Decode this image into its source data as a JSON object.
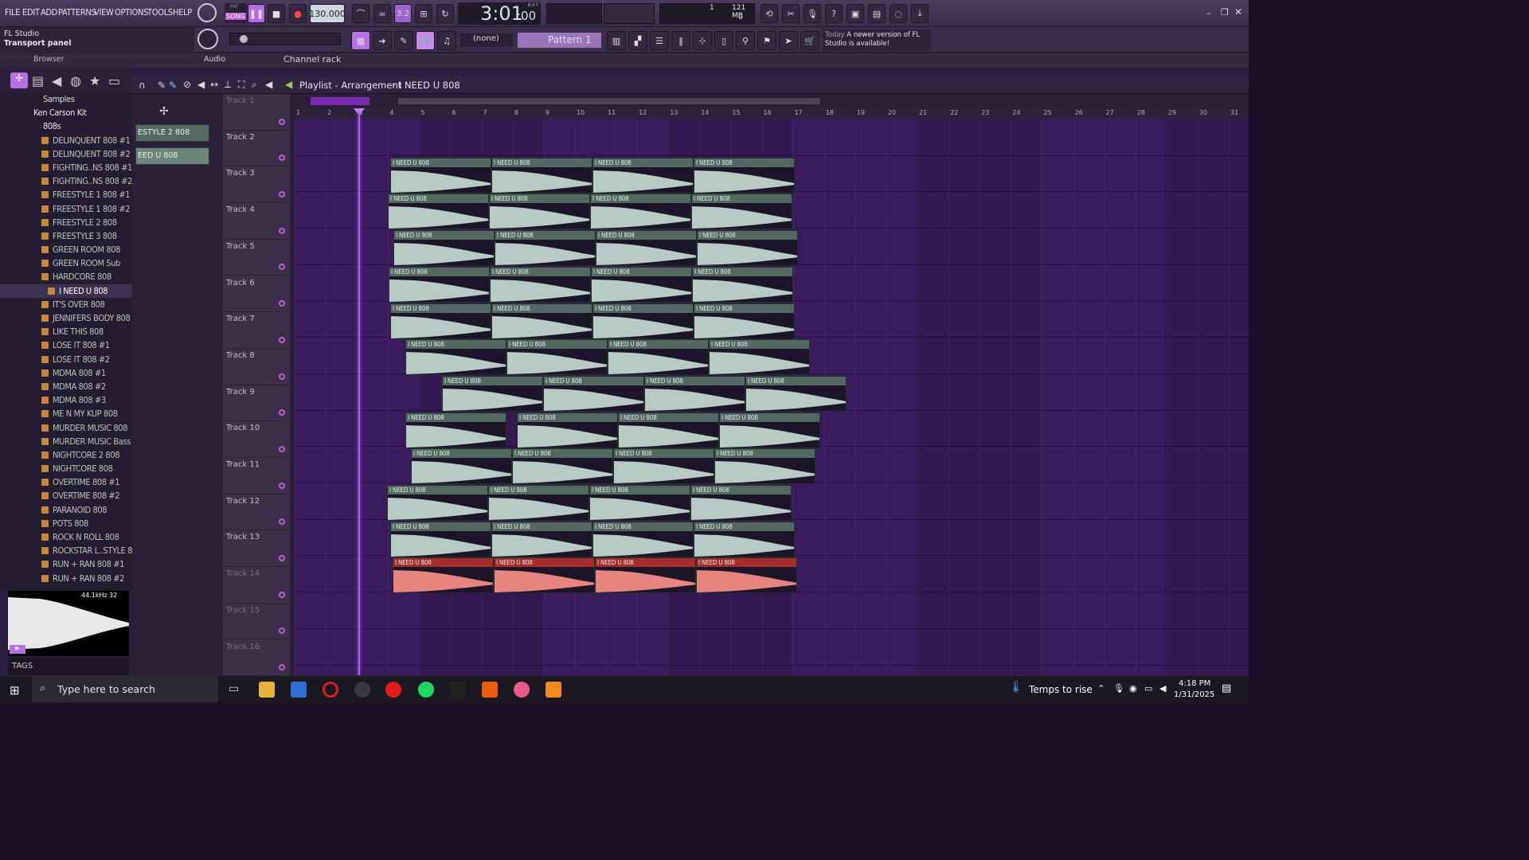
{
  "menu": [
    "FILE",
    "EDIT",
    "ADD",
    "PATTERNS",
    "VIEW",
    "OPTIONS",
    "TOOLS",
    "HELP"
  ],
  "transport": {
    "mode_pat": "PAT",
    "mode_song": "SONG",
    "tempo": "130.000",
    "time": "3:01",
    "time_ms": ":00",
    "time_label": "B:S:T",
    "beat_div": "3.2",
    "cpu": "1",
    "memory": "121 MB",
    "voices": "0"
  },
  "hint": {
    "app": "FL Studio",
    "panel": "Transport panel"
  },
  "toolbar2": {
    "snap": "(none)",
    "pattern": "Pattern 1"
  },
  "news": {
    "when": "Today",
    "text": "A newer version of FL Studio is available!"
  },
  "browser": {
    "title": "Browser",
    "channel_rack": "Channel rack",
    "audio": "Audio",
    "samples": "Samples",
    "artist": "Ken Carson Kit",
    "folder": "808s",
    "items": [
      "DELINQUENT 808 #1",
      "DELINQUENT 808 #2",
      "FIGHTING..NS 808 #1",
      "FIGHTING..NS 808 #2",
      "FREESTYLE 1 808 #1",
      "FREESTYLE 1 808 #2",
      "FREESTYLE 2 808",
      "FREESTYLE 3 808",
      "GREEN ROOM 808",
      "GREEN ROOM Sub",
      "HARDCORE 808",
      "I NEED U 808",
      "IT'S OVER 808",
      "JENNIFERS BODY 808",
      "LIKE THIS 808",
      "LOSE IT 808 #1",
      "LOSE IT 808 #2",
      "MDMA 808 #1",
      "MDMA 808 #2",
      "MDMA 808 #3",
      "ME N MY KUP 808",
      "MURDER MUSIC 808",
      "MURDER MUSIC Bass",
      "NIGHTCORE 2 808",
      "NIGHTCORE 808",
      "OVERTIME 808 #1",
      "OVERTIME 808 #2",
      "PARANOID 808",
      "POTS 808",
      "ROCK N ROLL 808",
      "ROCKSTAR L..STYLE 808",
      "RUN + RAN 808 #1",
      "RUN + RAN 808 #2"
    ],
    "selected": "I NEED U 808",
    "sample_rate": "44.1kHz",
    "bits": "32",
    "tags": "TAGS"
  },
  "channels": [
    "ESTYLE 2 808",
    "EED U 808"
  ],
  "playlist": {
    "breadcrumb_a": "Playlist - Arrangement",
    "breadcrumb_b": "I NEED U 808",
    "clip_name": "I NEED U 808",
    "tracks": [
      "Track 1",
      "Track 2",
      "Track 3",
      "Track 4",
      "Track 5",
      "Track 6",
      "Track 7",
      "Track 8",
      "Track 9",
      "Track 10",
      "Track 11",
      "Track 12",
      "Track 13",
      "Track 14",
      "Track 15",
      "Track 16"
    ],
    "ruler": [
      "1",
      "2",
      "3",
      "4",
      "5",
      "6",
      "7",
      "8",
      "9",
      "10",
      "11",
      "12",
      "13",
      "14",
      "15",
      "16",
      "17",
      "18",
      "19",
      "20",
      "21",
      "22",
      "23",
      "24",
      "25",
      "26",
      "27",
      "28",
      "29",
      "30",
      "31"
    ]
  },
  "taskbar": {
    "search": "Type here to search",
    "weather": "Temps to rise",
    "time": "4:18 PM",
    "date": "1/31/2025"
  },
  "colors": {
    "accent": "#b25cff",
    "clip": "#526861",
    "clip_red": "#a52c2a",
    "wave": "#b7cac4",
    "wave_red": "#e8847e"
  }
}
